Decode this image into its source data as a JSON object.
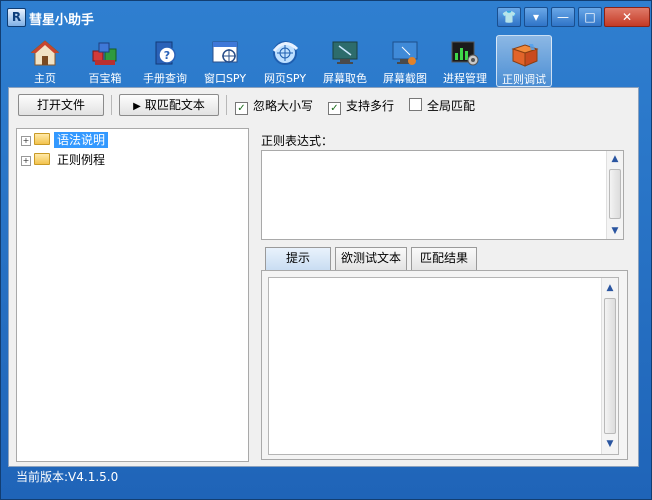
{
  "window": {
    "title": "彗星小助手",
    "logo_letter": "R",
    "controls": {
      "skin": "👕",
      "menu": "▾",
      "minimize": "—",
      "maximize": "□",
      "close": "✕"
    }
  },
  "toolbar": {
    "items": [
      {
        "label": "主页",
        "icon": "home-icon"
      },
      {
        "label": "百宝箱",
        "icon": "toolbox-icon"
      },
      {
        "label": "手册查询",
        "icon": "manual-help-icon"
      },
      {
        "label": "窗口SPY",
        "icon": "window-spy-icon"
      },
      {
        "label": "网页SPY",
        "icon": "web-spy-icon"
      },
      {
        "label": "屏幕取色",
        "icon": "color-picker-icon"
      },
      {
        "label": "屏幕截图",
        "icon": "screenshot-icon"
      },
      {
        "label": "进程管理",
        "icon": "process-manager-icon"
      },
      {
        "label": "正则调试",
        "icon": "regex-debug-icon",
        "active": true
      }
    ]
  },
  "commands": {
    "open_file": "打开文件",
    "fetch_match_text": "取匹配文本",
    "play_glyph": "▶",
    "ignore_case": {
      "label": "忽略大小写",
      "checked": true
    },
    "multiline": {
      "label": "支持多行",
      "checked": true
    },
    "global_match": {
      "label": "全局匹配",
      "checked": false
    }
  },
  "tree": {
    "nodes": [
      {
        "label": "语法说明",
        "selected": true
      },
      {
        "label": "正则例程",
        "selected": false
      }
    ]
  },
  "regex": {
    "label": "正则表达式：",
    "value": ""
  },
  "tabs": [
    {
      "label": "提示",
      "active": true
    },
    {
      "label": "欲测试文本",
      "active": false
    },
    {
      "label": "匹配结果",
      "active": false
    }
  ],
  "status": {
    "version_text": "当前版本:V4.1.5.0"
  }
}
